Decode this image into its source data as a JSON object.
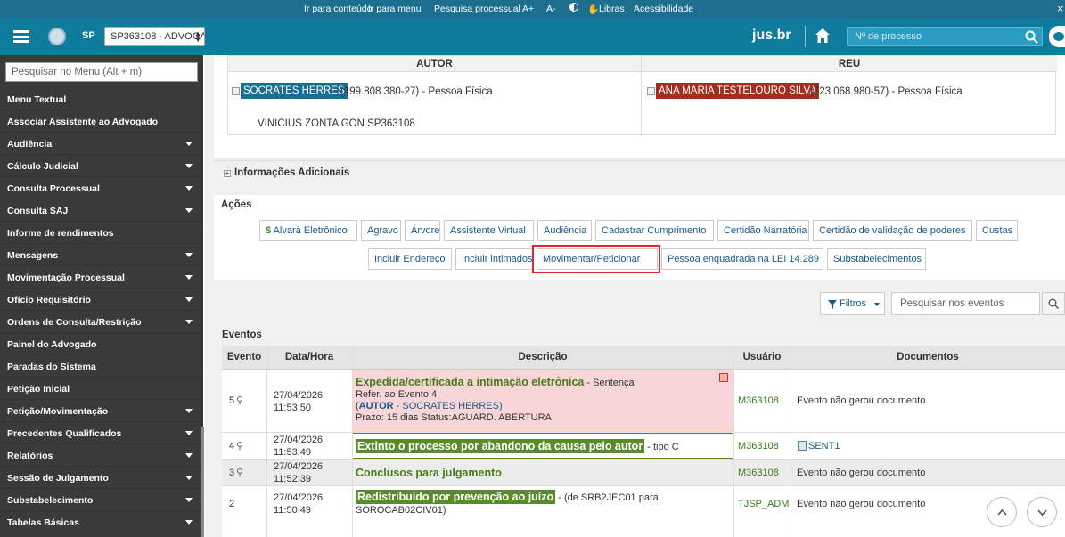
{
  "topbar": {
    "skip_content": "Ir para conteúdo",
    "skip_menu": "Ir para menu",
    "search_process": "Pesquisa processual",
    "font_up": "A+",
    "font_down": "A-",
    "libras": "Libras",
    "accessibility": "Acessibilidade",
    "close": "×"
  },
  "header": {
    "state": "SP",
    "profile": "SP363108 - ADVOGA",
    "brand": "jus.br",
    "process_placeholder": "Nº de processo"
  },
  "sidebar": {
    "search_placeholder": "Pesquisar no Menu (Alt + m)",
    "items": [
      {
        "label": "Menu Textual",
        "arrow": false
      },
      {
        "label": "Associar Assistente ao Advogado",
        "arrow": false
      },
      {
        "label": "Audiência",
        "arrow": true
      },
      {
        "label": "Cálculo Judicial",
        "arrow": true
      },
      {
        "label": "Consulta Processual",
        "arrow": true
      },
      {
        "label": "Consulta SAJ",
        "arrow": true
      },
      {
        "label": "Informe de rendimentos",
        "arrow": false
      },
      {
        "label": "Mensagens",
        "arrow": true
      },
      {
        "label": "Movimentação Processual",
        "arrow": true
      },
      {
        "label": "Ofício Requisitório",
        "arrow": true
      },
      {
        "label": "Ordens de Consulta/Restrição",
        "arrow": true
      },
      {
        "label": "Painel do Advogado",
        "arrow": false
      },
      {
        "label": "Paradas do Sistema",
        "arrow": false
      },
      {
        "label": "Petição Inicial",
        "arrow": false
      },
      {
        "label": "Petição/Movimentação",
        "arrow": true
      },
      {
        "label": "Precedentes Qualificados",
        "arrow": true
      },
      {
        "label": "Relatórios",
        "arrow": true
      },
      {
        "label": "Sessão de Julgamento",
        "arrow": true
      },
      {
        "label": "Substabelecimento",
        "arrow": true
      },
      {
        "label": "Tabelas Básicas",
        "arrow": true
      }
    ]
  },
  "parties": {
    "autor_header": "AUTOR",
    "reu_header": "REU",
    "autor_name": "SOCRATES HERRES",
    "autor_doc": "(199.808.380-27) - Pessoa Física",
    "autor_lawyer": "VINICIUS ZONTA GON  SP363108",
    "reu_name": "ANA MARIA TESTELOURO SILVA",
    "reu_doc": "(723.068.980-57) - Pessoa Física",
    "autor_color": "#1c6e8e",
    "reu_color": "#a32d1e"
  },
  "info_additional": "Informações Adicionais",
  "actions": {
    "title": "Ações",
    "row1": [
      "Alvará Eletrônico",
      "Agravo",
      "Árvore",
      "Assistente Virtual",
      "Audiência",
      "Cadastrar Cumprimento",
      "Certidão Narratória",
      "Certidão de validação de poderes",
      "Custas"
    ],
    "row2": [
      "Incluir Endereço",
      "Incluir intimados",
      "Movimentar/Peticionar",
      "Pessoa enquadrada na LEI 14.289",
      "Substabelecimentos"
    ],
    "dollar": "$"
  },
  "filters": {
    "label": "Filtros",
    "placeholder": "Pesquisar nos eventos"
  },
  "events": {
    "title": "Eventos",
    "headers": [
      "Evento",
      "Data/Hora",
      "Descrição",
      "Usuário",
      "Documentos"
    ],
    "rows": [
      {
        "num": "5",
        "date": "27/04/2026",
        "time": "11:53:50",
        "title": "Expedida/certificada a intimação eletrônica",
        "suffix": " - Sentença",
        "line2": "Refer. ao Evento 4",
        "line3_role": "AUTOR",
        "line3_rest": " - SOCRATES HERRES)",
        "line3_open": "(",
        "line4": "Prazo: 15 dias Status:AGUARD. ABERTURA",
        "user": "M363108",
        "doc": "Evento não gerou documento"
      },
      {
        "num": "4",
        "date": "27/04/2026",
        "time": "11:53:49",
        "title": "Extinto o processo por abandono da causa pelo autor",
        "suffix": " - tipo C",
        "user": "M363108",
        "doc": "SENT1"
      },
      {
        "num": "3",
        "date": "27/04/2026",
        "time": "11:52:39",
        "title": "Conclusos para julgamento",
        "user": "M363108",
        "doc": "Evento não gerou documento"
      },
      {
        "num": "2",
        "date": "27/04/2026",
        "time": "11:50:49",
        "title": "Redistribuído por prevenção ao juízo",
        "suffix": " - (de SRB2JEC01 para",
        "line2": "SOROCAB02CIV01)",
        "user": "TJSP_ADM",
        "doc": "Evento não gerou documento"
      }
    ]
  },
  "colors": {
    "highlight_red": "#e3262b",
    "pink_row": "#f6d6d6",
    "brand_blue": "#0f7c9e"
  }
}
